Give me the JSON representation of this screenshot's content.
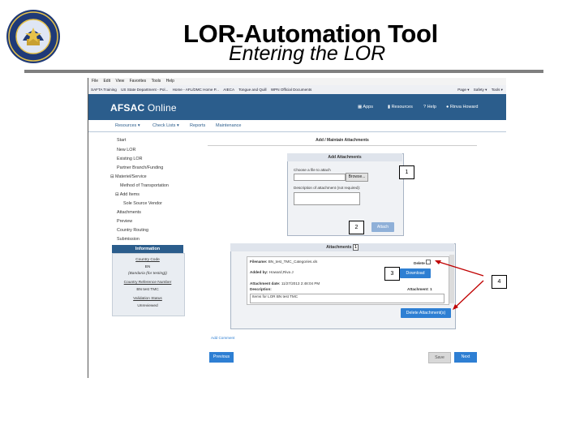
{
  "slide": {
    "title": "LOR-Automation Tool",
    "subtitle": "Entering the LOR"
  },
  "browser": {
    "menu": [
      "File",
      "Edit",
      "View",
      "Favorites",
      "Tools",
      "Help"
    ],
    "favorites": [
      "SAFTA Training",
      "US State Department - Pol...",
      "Home - AFL/DMC Home P...",
      "AIECA",
      "Tongue and Quill",
      "WPN Official Documents"
    ],
    "commands": [
      "Page ▾",
      "Safety ▾",
      "Tools ▾"
    ]
  },
  "app": {
    "brand_primary": "AFSAC",
    "brand_secondary": "Online",
    "top_nav": [
      "Apps",
      "Resources",
      "Help",
      "Rinva Howard"
    ],
    "sub_nav": [
      "Resources ▾",
      "Check Lists ▾",
      "Reports",
      "Maintenance"
    ],
    "colors": {
      "header": "#2b5d8c",
      "button": "#2e7fd3"
    }
  },
  "sidebar": {
    "items": [
      "Start",
      "New LOR",
      "Existing LOR",
      "Partner Branch/Funding",
      "Materiel/Service",
      "Method of Transportation",
      "Add Items",
      "Sole Source Vendor",
      "Attachments",
      "Preview",
      "Country Routing",
      "Submission"
    ]
  },
  "info": {
    "title": "Information",
    "lines": [
      "Country Code",
      "BN",
      "(Bandaria (for testing))",
      "Country Reference Number",
      "BN test TMC",
      "Validation Status",
      "Unreviewed"
    ]
  },
  "page": {
    "heading": "Add / Maintain Attachments"
  },
  "add_attachments": {
    "title": "Add Attachments",
    "choose_label": "Choose a file to attach",
    "browse_label": "Browse...",
    "desc_label": "Description of attachment (not required):",
    "attach_label": "Attach"
  },
  "attachments": {
    "title": "Attachments",
    "count": "1",
    "filename_label": "Filename:",
    "filename": "BN_test_TMC_Categories.xls",
    "delete_label": "Delete",
    "added_by_label": "Added by:",
    "added_by": "Howard,Riva J",
    "date_label": "Attachment date:",
    "date": "11/27/2013 2:48:04 PM",
    "description_label": "Description:",
    "attachment_label": "Attachment: 1",
    "description": "Items for LOR BN test TMC",
    "download_label": "Download",
    "delete_button_label": "Delete Attachment(s)"
  },
  "footer": {
    "add_comment": "Add Comment",
    "previous": "Previous",
    "save": "Save",
    "next": "Next"
  },
  "callouts": [
    "1",
    "2",
    "3",
    "4"
  ]
}
